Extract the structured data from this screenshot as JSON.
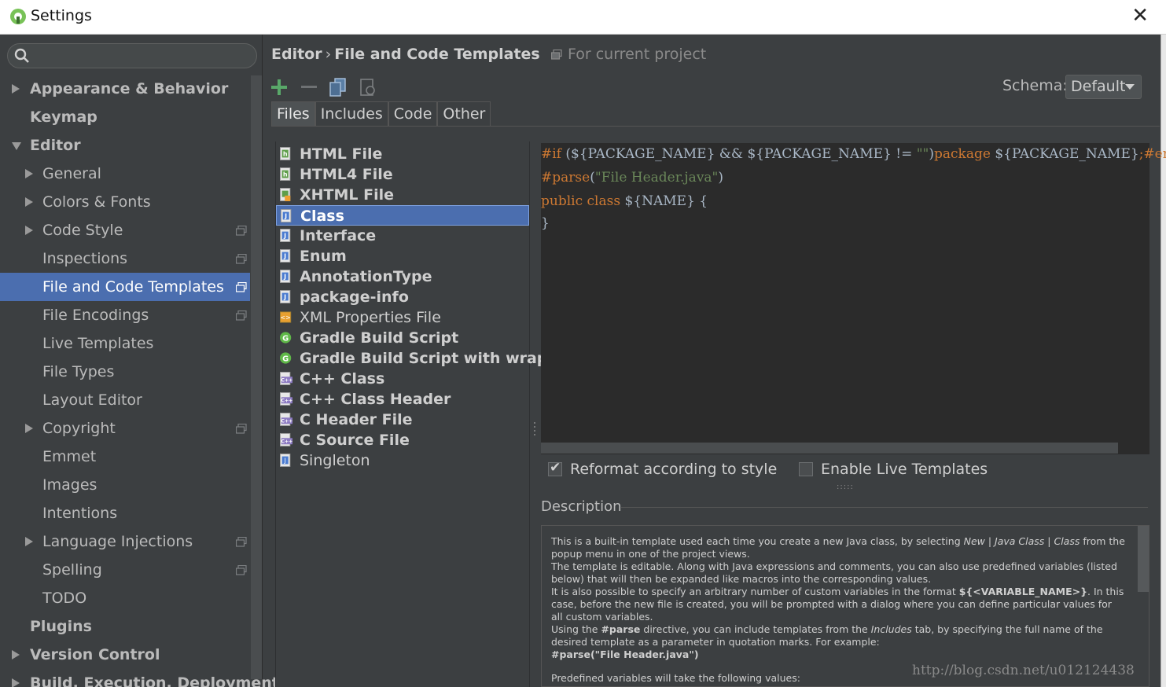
{
  "window": {
    "title": "Settings",
    "close_glyph": "✕"
  },
  "sidebar": {
    "search_placeholder": "",
    "items": [
      {
        "label": "Appearance & Behavior",
        "bold": true,
        "arrow": "right",
        "indent": 0
      },
      {
        "label": "Keymap",
        "bold": true,
        "arrow": "none",
        "indent": 0
      },
      {
        "label": "Editor",
        "bold": true,
        "arrow": "down",
        "indent": 0
      },
      {
        "label": "General",
        "arrow": "right",
        "indent": 1
      },
      {
        "label": "Colors & Fonts",
        "arrow": "right",
        "indent": 1
      },
      {
        "label": "Code Style",
        "arrow": "right",
        "indent": 1,
        "project_icon": true
      },
      {
        "label": "Inspections",
        "arrow": "none",
        "indent": 1,
        "project_icon": true
      },
      {
        "label": "File and Code Templates",
        "arrow": "none",
        "indent": 1,
        "project_icon": true,
        "selected": true
      },
      {
        "label": "File Encodings",
        "arrow": "none",
        "indent": 1,
        "project_icon": true
      },
      {
        "label": "Live Templates",
        "arrow": "none",
        "indent": 1
      },
      {
        "label": "File Types",
        "arrow": "none",
        "indent": 1
      },
      {
        "label": "Layout Editor",
        "arrow": "none",
        "indent": 1
      },
      {
        "label": "Copyright",
        "arrow": "right",
        "indent": 1,
        "project_icon": true
      },
      {
        "label": "Emmet",
        "arrow": "none",
        "indent": 1
      },
      {
        "label": "Images",
        "arrow": "none",
        "indent": 1
      },
      {
        "label": "Intentions",
        "arrow": "none",
        "indent": 1
      },
      {
        "label": "Language Injections",
        "arrow": "right",
        "indent": 1,
        "project_icon": true
      },
      {
        "label": "Spelling",
        "arrow": "none",
        "indent": 1,
        "project_icon": true
      },
      {
        "label": "TODO",
        "arrow": "none",
        "indent": 1
      },
      {
        "label": "Plugins",
        "bold": true,
        "arrow": "none",
        "indent": 0
      },
      {
        "label": "Version Control",
        "bold": true,
        "arrow": "right",
        "indent": 0
      },
      {
        "label": "Build, Execution, Deployment",
        "bold": true,
        "arrow": "right",
        "indent": 0
      }
    ]
  },
  "breadcrumb": {
    "parent": "Editor",
    "separator": "›",
    "current": "File and Code Templates",
    "scope": "For current project"
  },
  "toolbar": {
    "add_icon": "plus-icon",
    "remove_icon": "minus-icon",
    "copy_icon": "copy-icon",
    "reset_icon": "reset-icon"
  },
  "schema": {
    "label": "Schema:",
    "value": "Default"
  },
  "tabs": [
    "Files",
    "Includes",
    "Code",
    "Other"
  ],
  "active_tab": "Files",
  "templates": [
    {
      "label": "HTML File",
      "bold": true,
      "icon": "html"
    },
    {
      "label": "HTML4 File",
      "bold": true,
      "icon": "html"
    },
    {
      "label": "XHTML File",
      "bold": true,
      "icon": "xhtml"
    },
    {
      "label": "Class",
      "bold": true,
      "icon": "java",
      "selected": true
    },
    {
      "label": "Interface",
      "bold": true,
      "icon": "java"
    },
    {
      "label": "Enum",
      "bold": true,
      "icon": "java"
    },
    {
      "label": "AnnotationType",
      "bold": true,
      "icon": "java"
    },
    {
      "label": "package-info",
      "bold": true,
      "icon": "java"
    },
    {
      "label": "XML Properties File",
      "bold": false,
      "icon": "xml"
    },
    {
      "label": "Gradle Build Script",
      "bold": true,
      "icon": "gradle"
    },
    {
      "label": "Gradle Build Script with wrapper",
      "bold": true,
      "icon": "gradle"
    },
    {
      "label": "C++ Class",
      "bold": true,
      "icon": "cpp"
    },
    {
      "label": "C++ Class Header",
      "bold": true,
      "icon": "cpp"
    },
    {
      "label": "C Header File",
      "bold": true,
      "icon": "cpp"
    },
    {
      "label": "C Source File",
      "bold": true,
      "icon": "cpp"
    },
    {
      "label": "Singleton",
      "bold": false,
      "icon": "java"
    }
  ],
  "editor": {
    "line1": {
      "a": "#if",
      "b": " (",
      "c": "${PACKAGE_NAME}",
      "d": " && ",
      "e": "${PACKAGE_NAME}",
      "f": " != ",
      "g": "\"\"",
      "h": ")",
      "i": "package",
      "j": " ",
      "k": "${PACKAGE_NAME}",
      "l": ";",
      "m": "#end"
    },
    "line2": {
      "a": "#parse",
      "b": "(",
      "c": "\"File Header.java\"",
      "d": ")"
    },
    "line3": {
      "a": "public",
      "b": " ",
      "c": "class",
      "d": " ",
      "e": "${NAME}",
      "f": " {"
    },
    "line4": {
      "a": "}"
    }
  },
  "options": {
    "reformat_label": "Reformat according to style",
    "reformat_checked": true,
    "live_templates_label": "Enable Live Templates",
    "live_templates_checked": false,
    "check_glyph": "✔"
  },
  "description": {
    "heading": "Description",
    "p1a": "This is a built-in template used each time you create a new Java class, by selecting ",
    "p1b": "New",
    "p1c": " | ",
    "p1d": "Java Class",
    "p1e": " | ",
    "p1f": "Class",
    "p1g": " from the popup menu in one of the project views.",
    "p2": "The template is editable. Along with Java expressions and comments, you can also use predefined variables (listed below) that will then be expanded like macros into the corresponding values.",
    "p3a": "It is also possible to specify an arbitrary number of custom variables in the format ",
    "p3b": "${<VARIABLE_NAME>}",
    "p3c": ". In this case, before the new file is created, you will be prompted with a dialog where you can define particular values for all custom variables.",
    "p4a": "Using the ",
    "p4b": "#parse",
    "p4c": " directive, you can include templates from the ",
    "p4d": "Includes",
    "p4e": " tab, by specifying the full name of the desired template as a parameter in quotation marks. For example:",
    "p5": "#parse(\"File Header.java\")",
    "p6": "Predefined variables will take the following values:"
  },
  "watermark": "http://blog.csdn.net/u012124438"
}
